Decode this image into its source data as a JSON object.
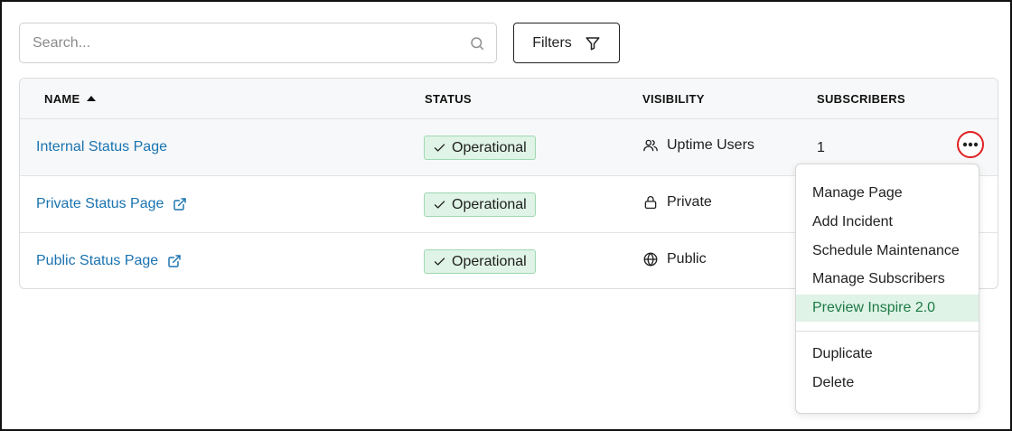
{
  "toolbar": {
    "search_placeholder": "Search...",
    "search_icon": "search-icon",
    "filters_label": "Filters",
    "filters_icon": "funnel-icon"
  },
  "table": {
    "columns": [
      {
        "label": "NAME",
        "sort": "ascending"
      },
      {
        "label": "STATUS"
      },
      {
        "label": "VISIBILITY"
      },
      {
        "label": "SUBSCRIBERS"
      }
    ],
    "rows": [
      {
        "name": "Internal Status Page",
        "external_link": false,
        "status": "Operational",
        "visibility": "Uptime Users",
        "visibility_icon": "users-icon",
        "subscribers": "1",
        "has_menu_button": true
      },
      {
        "name": "Private Status Page",
        "external_link": true,
        "status": "Operational",
        "visibility": "Private",
        "visibility_icon": "lock-icon",
        "subscribers": ""
      },
      {
        "name": "Public Status Page",
        "external_link": true,
        "status": "Operational",
        "visibility": "Public",
        "visibility_icon": "globe-icon",
        "subscribers": ""
      }
    ]
  },
  "row_menu": {
    "items": [
      {
        "label": "Manage Page"
      },
      {
        "label": "Add Incident"
      },
      {
        "label": "Schedule Maintenance"
      },
      {
        "label": "Manage Subscribers"
      },
      {
        "label": "Preview Inspire 2.0",
        "highlighted": true
      }
    ],
    "secondary_items": [
      {
        "label": "Duplicate"
      },
      {
        "label": "Delete"
      }
    ]
  },
  "colors": {
    "link": "#1a73b0",
    "status_bg": "#dff3e6",
    "status_border": "#9fd8b2",
    "highlight_text": "#1d7a46",
    "menu_button_ring": "#e02020"
  }
}
